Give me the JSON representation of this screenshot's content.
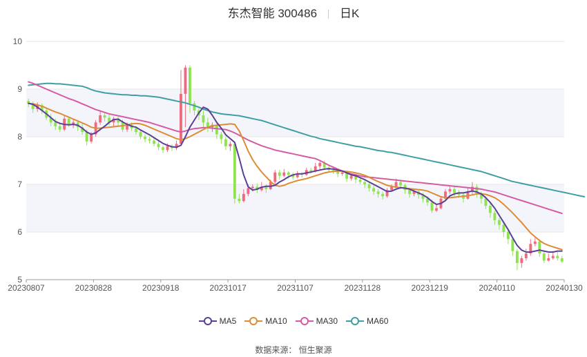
{
  "header": {
    "stock": "东杰智能 300486",
    "period": "日K"
  },
  "footer": {
    "source": "数据来源： 恒生聚源"
  },
  "colors": {
    "up": "#ee6b7f",
    "down": "#8fe351",
    "ma5": "#5b3e96",
    "ma10": "#de8b35",
    "ma30": "#d65aa3",
    "ma60": "#3f9ea3",
    "band": "#f3f5fb",
    "grid": "#e6e6e6"
  },
  "chart_data": {
    "type": "candlestick",
    "ylim": [
      5,
      10
    ],
    "yticks": [
      5,
      6,
      7,
      8,
      9,
      10
    ],
    "xlabels": [
      "20230807",
      "20230828",
      "20230918",
      "20231017",
      "20231107",
      "20231128",
      "20231219",
      "20240110",
      "20240130"
    ],
    "xlabel_index": [
      0,
      15,
      30,
      45,
      60,
      75,
      90,
      105,
      119
    ],
    "legend": [
      "MA5",
      "MA10",
      "MA30",
      "MA60"
    ],
    "candles": [
      [
        8.75,
        8.7,
        8.8,
        8.62
      ],
      [
        8.7,
        8.58,
        8.74,
        8.5
      ],
      [
        8.58,
        8.66,
        8.72,
        8.52
      ],
      [
        8.66,
        8.55,
        8.7,
        8.48
      ],
      [
        8.55,
        8.4,
        8.6,
        8.35
      ],
      [
        8.4,
        8.3,
        8.48,
        8.22
      ],
      [
        8.3,
        8.22,
        8.38,
        8.14
      ],
      [
        8.22,
        8.15,
        8.3,
        8.1
      ],
      [
        8.15,
        8.38,
        8.45,
        8.12
      ],
      [
        8.38,
        8.25,
        8.42,
        8.2
      ],
      [
        8.25,
        8.3,
        8.36,
        8.18
      ],
      [
        8.3,
        8.2,
        8.34,
        8.12
      ],
      [
        8.2,
        8.1,
        8.28,
        8.04
      ],
      [
        8.1,
        7.9,
        8.15,
        7.82
      ],
      [
        7.9,
        8.05,
        8.1,
        7.86
      ],
      [
        8.05,
        8.3,
        8.35,
        8.0
      ],
      [
        8.3,
        8.45,
        8.55,
        8.25
      ],
      [
        8.45,
        8.4,
        8.52,
        8.32
      ],
      [
        8.4,
        8.3,
        8.46,
        8.24
      ],
      [
        8.3,
        8.38,
        8.42,
        8.22
      ],
      [
        8.38,
        8.3,
        8.42,
        8.22
      ],
      [
        8.3,
        8.15,
        8.36,
        8.1
      ],
      [
        8.15,
        8.25,
        8.3,
        8.1
      ],
      [
        8.25,
        8.18,
        8.3,
        8.12
      ],
      [
        8.18,
        8.1,
        8.22,
        8.04
      ],
      [
        8.1,
        8.0,
        8.15,
        7.95
      ],
      [
        8.0,
        7.95,
        8.05,
        7.88
      ],
      [
        7.95,
        7.92,
        8.0,
        7.86
      ],
      [
        7.92,
        7.85,
        7.96,
        7.8
      ],
      [
        7.85,
        7.78,
        7.9,
        7.72
      ],
      [
        7.78,
        7.72,
        7.82,
        7.66
      ],
      [
        7.72,
        7.8,
        7.86,
        7.68
      ],
      [
        7.8,
        7.76,
        7.84,
        7.7
      ],
      [
        7.76,
        7.85,
        7.92,
        7.72
      ],
      [
        7.85,
        8.9,
        9.4,
        7.85
      ],
      [
        8.9,
        9.45,
        9.5,
        8.2
      ],
      [
        9.45,
        8.7,
        9.5,
        8.5
      ],
      [
        8.7,
        8.55,
        8.75,
        8.45
      ],
      [
        8.55,
        8.45,
        8.6,
        8.35
      ],
      [
        8.45,
        8.3,
        8.55,
        8.2
      ],
      [
        8.3,
        8.2,
        8.4,
        8.1
      ],
      [
        8.2,
        8.25,
        8.3,
        8.1
      ],
      [
        8.25,
        8.05,
        8.3,
        7.95
      ],
      [
        8.05,
        7.95,
        8.1,
        7.85
      ],
      [
        7.95,
        7.8,
        8.0,
        7.72
      ],
      [
        7.8,
        7.85,
        7.9,
        7.7
      ],
      [
        7.85,
        6.7,
        6.85,
        6.6
      ],
      [
        6.7,
        6.65,
        6.8,
        6.6
      ],
      [
        6.65,
        6.8,
        6.9,
        6.62
      ],
      [
        6.8,
        6.92,
        7.0,
        6.75
      ],
      [
        6.92,
        6.95,
        7.0,
        6.85
      ],
      [
        6.95,
        6.88,
        7.02,
        6.82
      ],
      [
        6.88,
        6.95,
        7.05,
        6.85
      ],
      [
        6.95,
        6.9,
        7.0,
        6.82
      ],
      [
        6.9,
        7.05,
        7.1,
        6.88
      ],
      [
        7.05,
        7.25,
        7.3,
        7.0
      ],
      [
        7.25,
        7.18,
        7.3,
        7.1
      ],
      [
        7.18,
        7.25,
        7.32,
        7.15
      ],
      [
        7.25,
        7.2,
        7.28,
        7.12
      ],
      [
        7.2,
        7.15,
        7.25,
        7.1
      ],
      [
        7.15,
        7.22,
        7.28,
        7.12
      ],
      [
        7.22,
        7.2,
        7.26,
        7.14
      ],
      [
        7.2,
        7.3,
        7.35,
        7.18
      ],
      [
        7.3,
        7.28,
        7.35,
        7.22
      ],
      [
        7.28,
        7.38,
        7.45,
        7.25
      ],
      [
        7.38,
        7.45,
        7.48,
        7.3
      ],
      [
        7.45,
        7.35,
        7.5,
        7.3
      ],
      [
        7.35,
        7.3,
        7.4,
        7.25
      ],
      [
        7.3,
        7.28,
        7.35,
        7.22
      ],
      [
        7.28,
        7.22,
        7.32,
        7.15
      ],
      [
        7.22,
        7.25,
        7.3,
        7.18
      ],
      [
        7.25,
        7.12,
        7.28,
        7.05
      ],
      [
        7.12,
        7.18,
        7.22,
        7.08
      ],
      [
        7.18,
        7.1,
        7.22,
        7.02
      ],
      [
        7.1,
        7.05,
        7.15,
        7.0
      ],
      [
        7.05,
        7.0,
        7.1,
        6.92
      ],
      [
        7.0,
        6.92,
        7.05,
        6.85
      ],
      [
        6.92,
        6.85,
        6.98,
        6.78
      ],
      [
        6.85,
        6.8,
        6.9,
        6.72
      ],
      [
        6.8,
        6.75,
        6.85,
        6.68
      ],
      [
        6.75,
        6.88,
        6.92,
        6.72
      ],
      [
        6.88,
        6.95,
        7.0,
        6.85
      ],
      [
        6.95,
        7.05,
        7.12,
        6.92
      ],
      [
        7.05,
        6.98,
        7.1,
        6.9
      ],
      [
        6.98,
        6.88,
        7.02,
        6.8
      ],
      [
        6.88,
        6.8,
        6.92,
        6.72
      ],
      [
        6.8,
        6.85,
        6.9,
        6.75
      ],
      [
        6.85,
        6.78,
        6.88,
        6.7
      ],
      [
        6.78,
        6.7,
        6.82,
        6.62
      ],
      [
        6.7,
        6.62,
        6.75,
        6.55
      ],
      [
        6.62,
        6.45,
        6.68,
        6.4
      ],
      [
        6.45,
        6.5,
        6.58,
        6.42
      ],
      [
        6.5,
        6.7,
        6.75,
        6.48
      ],
      [
        6.7,
        6.85,
        6.9,
        6.65
      ],
      [
        6.85,
        6.9,
        6.95,
        6.8
      ],
      [
        6.9,
        6.82,
        6.95,
        6.75
      ],
      [
        6.82,
        6.78,
        6.88,
        6.72
      ],
      [
        6.78,
        6.7,
        6.82,
        6.62
      ],
      [
        6.7,
        6.85,
        6.92,
        6.68
      ],
      [
        6.85,
        6.95,
        7.05,
        6.8
      ],
      [
        6.95,
        6.8,
        7.0,
        6.72
      ],
      [
        6.8,
        6.7,
        6.85,
        6.6
      ],
      [
        6.7,
        6.55,
        6.75,
        6.48
      ],
      [
        6.55,
        6.4,
        6.6,
        6.3
      ],
      [
        6.4,
        6.25,
        6.45,
        6.15
      ],
      [
        6.25,
        6.15,
        6.3,
        6.05
      ],
      [
        6.15,
        6.0,
        6.2,
        5.9
      ],
      [
        6.0,
        5.85,
        6.05,
        5.75
      ],
      [
        5.85,
        5.6,
        5.9,
        5.5
      ],
      [
        5.6,
        5.35,
        5.65,
        5.2
      ],
      [
        5.35,
        5.45,
        5.5,
        5.25
      ],
      [
        5.45,
        5.55,
        5.65,
        5.4
      ],
      [
        5.55,
        5.75,
        5.85,
        5.5
      ],
      [
        5.75,
        5.8,
        5.88,
        5.7
      ],
      [
        5.8,
        5.55,
        5.85,
        5.48
      ],
      [
        5.55,
        5.4,
        5.6,
        5.35
      ],
      [
        5.4,
        5.45,
        5.55,
        5.38
      ],
      [
        5.45,
        5.5,
        5.6,
        5.42
      ],
      [
        5.5,
        5.45,
        5.58,
        5.4
      ],
      [
        5.45,
        5.38,
        5.5,
        5.35
      ]
    ],
    "ma5": [
      8.7,
      8.68,
      8.62,
      8.55,
      8.48,
      8.4,
      8.32,
      8.28,
      8.26,
      8.25,
      8.26,
      8.24,
      8.18,
      8.1,
      8.05,
      8.08,
      8.15,
      8.22,
      8.3,
      8.36,
      8.37,
      8.31,
      8.26,
      8.22,
      8.2,
      8.14,
      8.09,
      8.04,
      7.98,
      7.92,
      7.86,
      7.82,
      7.79,
      7.78,
      7.82,
      8.0,
      8.2,
      8.35,
      8.5,
      8.62,
      8.58,
      8.45,
      8.3,
      8.18,
      8.04,
      7.96,
      7.88,
      7.55,
      7.2,
      6.95,
      6.88,
      6.9,
      6.94,
      6.96,
      6.96,
      6.98,
      7.05,
      7.1,
      7.16,
      7.2,
      7.22,
      7.22,
      7.24,
      7.26,
      7.28,
      7.3,
      7.32,
      7.33,
      7.32,
      7.3,
      7.28,
      7.24,
      7.2,
      7.18,
      7.14,
      7.1,
      7.05,
      7.0,
      6.95,
      6.9,
      6.85,
      6.86,
      6.9,
      6.93,
      6.92,
      6.9,
      6.86,
      6.82,
      6.78,
      6.72,
      6.64,
      6.58,
      6.6,
      6.66,
      6.76,
      6.8,
      6.82,
      6.82,
      6.84,
      6.86,
      6.84,
      6.8,
      6.72,
      6.62,
      6.5,
      6.35,
      6.2,
      6.05,
      5.88,
      5.72,
      5.62,
      5.58,
      5.58,
      5.6,
      5.62,
      5.6,
      5.58,
      5.58,
      5.6,
      5.6
    ],
    "ma10": [
      8.7,
      8.69,
      8.67,
      8.64,
      8.6,
      8.56,
      8.52,
      8.49,
      8.45,
      8.41,
      8.37,
      8.33,
      8.29,
      8.25,
      8.2,
      8.18,
      8.18,
      8.19,
      8.2,
      8.21,
      8.22,
      8.23,
      8.25,
      8.27,
      8.28,
      8.27,
      8.24,
      8.2,
      8.16,
      8.12,
      8.08,
      8.04,
      8.0,
      7.96,
      7.94,
      7.96,
      8.0,
      8.05,
      8.1,
      8.15,
      8.2,
      8.23,
      8.24,
      8.25,
      8.26,
      8.27,
      8.26,
      8.12,
      7.92,
      7.7,
      7.52,
      7.38,
      7.26,
      7.16,
      7.06,
      6.98,
      6.96,
      6.98,
      7.02,
      7.05,
      7.08,
      7.1,
      7.12,
      7.15,
      7.18,
      7.21,
      7.24,
      7.26,
      7.27,
      7.28,
      7.28,
      7.27,
      7.26,
      7.24,
      7.22,
      7.19,
      7.15,
      7.1,
      7.06,
      7.02,
      6.98,
      6.96,
      6.94,
      6.93,
      6.92,
      6.91,
      6.9,
      6.89,
      6.88,
      6.86,
      6.82,
      6.78,
      6.74,
      6.72,
      6.72,
      6.73,
      6.74,
      6.75,
      6.76,
      6.78,
      6.8,
      6.8,
      6.79,
      6.76,
      6.72,
      6.66,
      6.58,
      6.49,
      6.4,
      6.3,
      6.2,
      6.09,
      5.98,
      5.9,
      5.82,
      5.76,
      5.72,
      5.69,
      5.66,
      5.63
    ],
    "ma30": [
      9.15,
      9.12,
      9.08,
      9.04,
      9.0,
      8.96,
      8.92,
      8.88,
      8.84,
      8.8,
      8.77,
      8.73,
      8.69,
      8.65,
      8.61,
      8.57,
      8.54,
      8.51,
      8.48,
      8.46,
      8.44,
      8.42,
      8.4,
      8.38,
      8.36,
      8.34,
      8.32,
      8.3,
      8.27,
      8.24,
      8.21,
      8.18,
      8.15,
      8.12,
      8.1,
      8.12,
      8.15,
      8.17,
      8.18,
      8.19,
      8.19,
      8.18,
      8.17,
      8.16,
      8.15,
      8.12,
      8.08,
      8.03,
      7.98,
      7.93,
      7.89,
      7.85,
      7.81,
      7.78,
      7.75,
      7.72,
      7.7,
      7.68,
      7.66,
      7.64,
      7.62,
      7.6,
      7.58,
      7.56,
      7.54,
      7.5,
      7.45,
      7.4,
      7.36,
      7.32,
      7.28,
      7.25,
      7.22,
      7.2,
      7.18,
      7.16,
      7.15,
      7.14,
      7.13,
      7.12,
      7.11,
      7.1,
      7.09,
      7.08,
      7.07,
      7.06,
      7.05,
      7.04,
      7.03,
      7.02,
      7.01,
      7.0,
      6.99,
      6.98,
      6.97,
      6.96,
      6.95,
      6.94,
      6.93,
      6.92,
      6.91,
      6.9,
      6.88,
      6.86,
      6.84,
      6.81,
      6.78,
      6.75,
      6.72,
      6.69,
      6.66,
      6.63,
      6.6,
      6.57,
      6.54,
      6.51,
      6.48,
      6.45,
      6.42,
      6.39
    ],
    "ma60": [
      9.08,
      9.09,
      9.1,
      9.11,
      9.12,
      9.12,
      9.11,
      9.11,
      9.1,
      9.09,
      9.08,
      9.07,
      9.06,
      9.03,
      8.99,
      8.96,
      8.94,
      8.92,
      8.91,
      8.9,
      8.89,
      8.88,
      8.88,
      8.87,
      8.87,
      8.86,
      8.86,
      8.85,
      8.84,
      8.83,
      8.81,
      8.79,
      8.77,
      8.75,
      8.73,
      8.71,
      8.68,
      8.65,
      8.62,
      8.58,
      8.55,
      8.52,
      8.5,
      8.48,
      8.47,
      8.46,
      8.45,
      8.44,
      8.42,
      8.4,
      8.38,
      8.36,
      8.34,
      8.31,
      8.28,
      8.25,
      8.22,
      8.19,
      8.16,
      8.13,
      8.1,
      8.07,
      8.04,
      8.01,
      7.99,
      7.96,
      7.94,
      7.92,
      7.9,
      7.88,
      7.86,
      7.84,
      7.82,
      7.8,
      7.79,
      7.77,
      7.75,
      7.73,
      7.71,
      7.7,
      7.68,
      7.67,
      7.65,
      7.63,
      7.61,
      7.59,
      7.57,
      7.55,
      7.53,
      7.51,
      7.49,
      7.47,
      7.45,
      7.43,
      7.41,
      7.39,
      7.37,
      7.35,
      7.33,
      7.31,
      7.29,
      7.27,
      7.24,
      7.21,
      7.18,
      7.15,
      7.12,
      7.09,
      7.06,
      7.04,
      7.02,
      7.0,
      6.98,
      6.96,
      6.94,
      6.92,
      6.9,
      6.88,
      6.86,
      6.84,
      6.82,
      6.8,
      6.78,
      6.76,
      6.74
    ]
  }
}
